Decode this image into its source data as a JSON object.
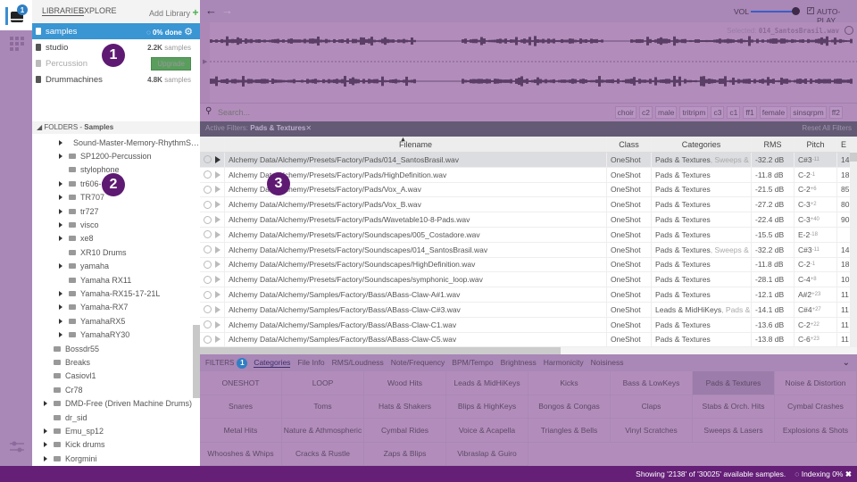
{
  "notification_count": "1",
  "sidebar": {
    "tabs": [
      "LIBRARIES",
      "EXPLORE"
    ],
    "add_library": "Add Library",
    "libraries": [
      {
        "name": "samples",
        "status": "0% done",
        "selected": true
      },
      {
        "name": "studio",
        "count": "2.2K",
        "unit": "samples"
      },
      {
        "name": "Percussion",
        "action": "Upgrade",
        "disabled": true
      },
      {
        "name": "Drummachines",
        "count": "4.8K",
        "unit": "samples"
      }
    ],
    "folders_label": "FOLDERS",
    "folders_lib": "Samples",
    "tree": [
      {
        "name": "Sound-Master-Memory-RhythmS…",
        "level": 1,
        "arrow": true
      },
      {
        "name": "SP1200-Percussion",
        "level": 1,
        "arrow": true
      },
      {
        "name": "stylophone",
        "level": 1,
        "arrow": false
      },
      {
        "name": "tr606-626",
        "level": 1,
        "arrow": true
      },
      {
        "name": "TR707",
        "level": 1,
        "arrow": true
      },
      {
        "name": "tr727",
        "level": 1,
        "arrow": true
      },
      {
        "name": "visco",
        "level": 1,
        "arrow": true
      },
      {
        "name": "xe8",
        "level": 1,
        "arrow": true
      },
      {
        "name": "XR10 Drums",
        "level": 1,
        "arrow": false
      },
      {
        "name": "yamaha",
        "level": 1,
        "arrow": true
      },
      {
        "name": "Yamaha RX11",
        "level": 1,
        "arrow": false
      },
      {
        "name": "Yamaha-RX15-17-21L",
        "level": 1,
        "arrow": true
      },
      {
        "name": "Yamaha-RX7",
        "level": 1,
        "arrow": true
      },
      {
        "name": "YamahaRX5",
        "level": 1,
        "arrow": true
      },
      {
        "name": "YamahaRY30",
        "level": 1,
        "arrow": true
      },
      {
        "name": "Bossdr55",
        "level": 0,
        "arrow": false
      },
      {
        "name": "Breaks",
        "level": 0,
        "arrow": false
      },
      {
        "name": "Casiovl1",
        "level": 0,
        "arrow": false
      },
      {
        "name": "Cr78",
        "level": 0,
        "arrow": false
      },
      {
        "name": "DMD-Free (Driven Machine Drums)",
        "level": 0,
        "arrow": true
      },
      {
        "name": "dr_sid",
        "level": 0,
        "arrow": false
      },
      {
        "name": "Emu_sp12",
        "level": 0,
        "arrow": true
      },
      {
        "name": "Kick drums",
        "level": 0,
        "arrow": true
      },
      {
        "name": "Korgmini",
        "level": 0,
        "arrow": true
      }
    ]
  },
  "callouts": [
    "1",
    "2",
    "3"
  ],
  "toolbar": {
    "vol_label": "VOL",
    "volume": 1.0,
    "autoplay_label": "AUTO-PLAY",
    "autoplay": true
  },
  "waveform": {
    "selected_label": "Selected:",
    "selected_file": "014_SantosBrasil.wav"
  },
  "search": {
    "placeholder": "Search...",
    "tags": [
      "choir",
      "c2",
      "male",
      "tritripm",
      "c3",
      "c1",
      "ff1",
      "female",
      "sinsqrpm",
      "ff2"
    ]
  },
  "active_filters": {
    "label": "Active Filters:",
    "filter": "Pads & Textures",
    "reset": "Reset All Filters"
  },
  "table": {
    "columns": [
      "Filename",
      "Class",
      "Categories",
      "RMS",
      "Pitch",
      "E"
    ],
    "rows": [
      {
        "file": "Alchemy Data/Alchemy/Presets/Factory/Pads/014_SantosBrasil.wav",
        "class": "OneShot",
        "cat": "Pads & Textures",
        "cat2": ", Sweeps & La",
        "rms": "-32.2 dB",
        "note": "C#3",
        "cents": "-11",
        "e": "14"
      },
      {
        "file": "Alchemy Data/Alchemy/Presets/Factory/Pads/HighDefinition.wav",
        "class": "OneShot",
        "cat": "Pads & Textures",
        "cat2": "",
        "rms": "-11.8 dB",
        "note": "C-2",
        "cents": "-1",
        "e": "18"
      },
      {
        "file": "Alchemy Data/Alchemy/Presets/Factory/Pads/Vox_A.wav",
        "class": "OneShot",
        "cat": "Pads & Textures",
        "cat2": "",
        "rms": "-21.5 dB",
        "note": "C-2",
        "cents": "+6",
        "e": "85"
      },
      {
        "file": "Alchemy Data/Alchemy/Presets/Factory/Pads/Vox_B.wav",
        "class": "OneShot",
        "cat": "Pads & Textures",
        "cat2": "",
        "rms": "-27.2 dB",
        "note": "C-3",
        "cents": "+2",
        "e": "80"
      },
      {
        "file": "Alchemy Data/Alchemy/Presets/Factory/Pads/Wavetable10-8-Pads.wav",
        "class": "OneShot",
        "cat": "Pads & Textures",
        "cat2": "",
        "rms": "-22.4 dB",
        "note": "C-3",
        "cents": "+40",
        "e": "90"
      },
      {
        "file": "Alchemy Data/Alchemy/Presets/Factory/Soundscapes/005_Costadore.wav",
        "class": "OneShot",
        "cat": "Pads & Textures",
        "cat2": "",
        "rms": "-15.5 dB",
        "note": "E-2",
        "cents": "-18",
        "e": ""
      },
      {
        "file": "Alchemy Data/Alchemy/Presets/Factory/Soundscapes/014_SantosBrasil.wav",
        "class": "OneShot",
        "cat": "Pads & Textures",
        "cat2": ", Sweeps & La",
        "rms": "-32.2 dB",
        "note": "C#3",
        "cents": "-11",
        "e": "14"
      },
      {
        "file": "Alchemy Data/Alchemy/Presets/Factory/Soundscapes/HighDefinition.wav",
        "class": "OneShot",
        "cat": "Pads & Textures",
        "cat2": "",
        "rms": "-11.8 dB",
        "note": "C-2",
        "cents": "-1",
        "e": "18"
      },
      {
        "file": "Alchemy Data/Alchemy/Presets/Factory/Soundscapes/symphonic_loop.wav",
        "class": "OneShot",
        "cat": "Pads & Textures",
        "cat2": "",
        "rms": "-28.1 dB",
        "note": "C-4",
        "cents": "+8",
        "e": "10"
      },
      {
        "file": "Alchemy Data/Alchemy/Samples/Factory/Bass/ABass-Claw-A#1.wav",
        "class": "OneShot",
        "cat": "Pads & Textures",
        "cat2": "",
        "rms": "-12.1 dB",
        "note": "A#2",
        "cents": "+23",
        "e": "11"
      },
      {
        "file": "Alchemy Data/Alchemy/Samples/Factory/Bass/ABass-Claw-C#3.wav",
        "class": "OneShot",
        "cat": "Leads & MidHiKeys",
        "cat2": ", Pads & Te",
        "rms": "-14.1 dB",
        "note": "C#4",
        "cents": "+27",
        "e": "11"
      },
      {
        "file": "Alchemy Data/Alchemy/Samples/Factory/Bass/ABass-Claw-C1.wav",
        "class": "OneShot",
        "cat": "Pads & Textures",
        "cat2": "",
        "rms": "-13.6 dB",
        "note": "C-2",
        "cents": "+22",
        "e": "11"
      },
      {
        "file": "Alchemy Data/Alchemy/Samples/Factory/Bass/ABass-Claw-C5.wav",
        "class": "OneShot",
        "cat": "Pads & Textures",
        "cat2": "",
        "rms": "-13.8 dB",
        "note": "C-6",
        "cents": "+23",
        "e": "11"
      }
    ]
  },
  "filters": {
    "label": "FILTERS",
    "count": "1",
    "tabs": [
      "Categories",
      "File Info",
      "RMS/Loudness",
      "Note/Frequency",
      "BPM/Tempo",
      "Brightness",
      "Harmonicity",
      "Noisiness"
    ],
    "categories": [
      "ONESHOT",
      "LOOP",
      "Wood Hits",
      "Leads & MidHiKeys",
      "Kicks",
      "Bass & LowKeys",
      "Pads & Textures",
      "Noise & Distortion",
      "Snares",
      "Toms",
      "Hats & Shakers",
      "Blips & HighKeys",
      "Bongos & Congas",
      "Claps",
      "Stabs & Orch. Hits",
      "Cymbal Crashes",
      "Metal Hits",
      "Nature & Athmospheric",
      "Cymbal Rides",
      "Voice & Acapella",
      "Triangles & Bells",
      "Vinyl Scratches",
      "Sweeps & Lasers",
      "Explosions & Shots",
      "Whooshes & Whips",
      "Cracks & Rustle",
      "Zaps & Blips",
      "Vibraslap & Guiro"
    ],
    "active_category": "Pads & Textures"
  },
  "status": {
    "showing": "Showing '2138' of '30025' available samples.",
    "indexing": "Indexing 0%"
  }
}
